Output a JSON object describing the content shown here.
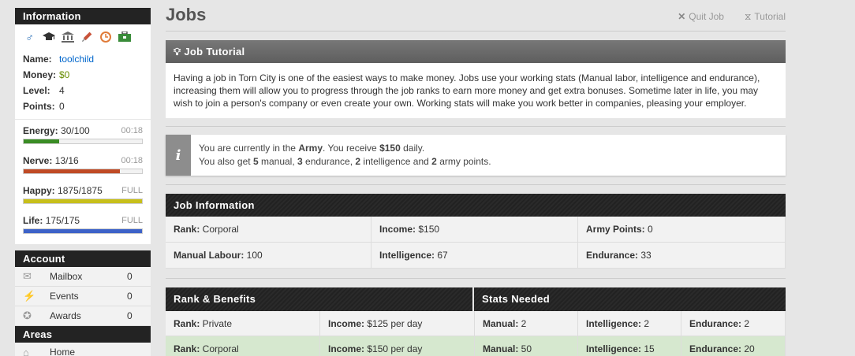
{
  "sidebar": {
    "info_title": "Information",
    "icons": [
      {
        "name": "male-gender-icon",
        "glyph": "♂",
        "color": "#2a6fb8"
      },
      {
        "name": "graduation-cap-icon",
        "glyph": "🎓",
        "color": "#333"
      },
      {
        "name": "bank-icon",
        "glyph": "🏛",
        "color": "#666"
      },
      {
        "name": "syringe-icon",
        "glyph": "✎",
        "color": "#c44"
      },
      {
        "name": "clock-icon",
        "glyph": "◔",
        "color": "#c60"
      },
      {
        "name": "briefcase-icon",
        "glyph": "💼",
        "color": "#393"
      }
    ],
    "name_label": "Name:",
    "name_value": "toolchild",
    "money_label": "Money:",
    "money_value": "$0",
    "level_label": "Level:",
    "level_value": "4",
    "points_label": "Points:",
    "points_value": "0",
    "bars": [
      {
        "name": "energy",
        "label": "Energy:",
        "value": "30/100",
        "time": "00:18",
        "fraction": 0.3,
        "color": "#3a8c24"
      },
      {
        "name": "nerve",
        "label": "Nerve:",
        "value": "13/16",
        "time": "00:18",
        "fraction": 0.8125,
        "color": "#c04a25"
      },
      {
        "name": "happy",
        "label": "Happy:",
        "value": "1875/1875",
        "time": "FULL",
        "fraction": 1.0,
        "color": "#c7bf1a"
      },
      {
        "name": "life",
        "label": "Life:",
        "value": "175/175",
        "time": "FULL",
        "fraction": 1.0,
        "color": "#3d62c8"
      }
    ],
    "account_title": "Account",
    "account_items": [
      {
        "name": "mailbox",
        "icon": "✉",
        "label": "Mailbox",
        "count": "0"
      },
      {
        "name": "events",
        "icon": "⚡",
        "label": "Events",
        "count": "0"
      },
      {
        "name": "awards",
        "icon": "✪",
        "label": "Awards",
        "count": "0"
      }
    ],
    "areas_title": "Areas",
    "areas_items": [
      {
        "name": "home",
        "icon": "⌂",
        "label": "Home"
      }
    ]
  },
  "main": {
    "title": "Jobs",
    "quit_job": "Quit Job",
    "tutorial": "Tutorial",
    "tutorial_title": "Job Tutorial",
    "tutorial_text": "Having a job in Torn City is one of the easiest ways to make money. Jobs use your working stats (Manual labor, intelligence and endurance), increasing them will allow you to progress through the job ranks to earn more money and get extra bonuses. Sometime later in life, you may wish to join a person's company or even create your own. Working stats will make you work better in companies, pleasing your employer.",
    "info_line1_pre": "You are currently in the ",
    "info_line1_job": "Army",
    "info_line1_mid": ". You receive ",
    "info_line1_pay": "$150",
    "info_line1_post": " daily.",
    "info_line2_pre": "You also get ",
    "info_manual": "5",
    "info_manual_txt": " manual, ",
    "info_endurance": "3",
    "info_endurance_txt": " endurance, ",
    "info_intel": "2",
    "info_intel_txt": " intelligence and ",
    "info_army": "2",
    "info_army_txt": " army points.",
    "job_info_title": "Job Information",
    "job_info": [
      {
        "label": "Rank:",
        "value": " Corporal"
      },
      {
        "label": "Income:",
        "value": " $150"
      },
      {
        "label": "Army Points:",
        "value": " 0"
      },
      {
        "label": "Manual Labour:",
        "value": " 100"
      },
      {
        "label": "Intelligence:",
        "value": " 67"
      },
      {
        "label": "Endurance:",
        "value": " 33"
      }
    ],
    "rank_title": "Rank & Benefits",
    "stats_title": "Stats Needed",
    "ranks": [
      {
        "rank": " Private",
        "income": " $125 per day",
        "manual": " 2",
        "intelligence": " 2",
        "endurance": " 2",
        "current": false
      },
      {
        "rank": " Corporal",
        "income": " $150 per day",
        "manual": " 50",
        "intelligence": " 15",
        "endurance": " 20",
        "current": true
      }
    ],
    "rank_label": "Rank:",
    "income_label": "Income:",
    "manual_label": "Manual:",
    "intelligence_label": "Intelligence:",
    "endurance_label": "Endurance:"
  }
}
